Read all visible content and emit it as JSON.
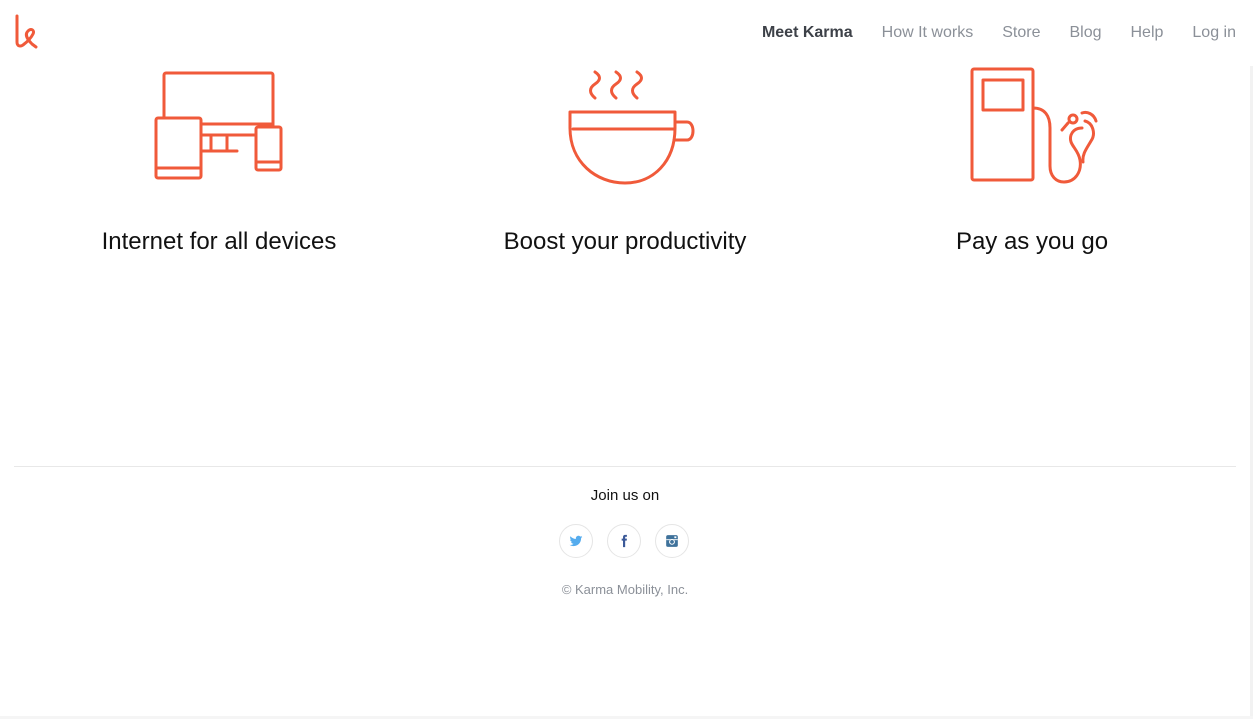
{
  "header": {
    "logo_icon": "karma-logo-icon",
    "nav": [
      {
        "label": "Meet Karma",
        "active": true
      },
      {
        "label": "How It works",
        "active": false
      },
      {
        "label": "Store",
        "active": false
      },
      {
        "label": "Blog",
        "active": false
      },
      {
        "label": "Help",
        "active": false
      },
      {
        "label": "Log in",
        "active": false
      }
    ]
  },
  "features": [
    {
      "icon": "devices-icon",
      "title": "Internet for all devices"
    },
    {
      "icon": "coffee-cup-icon",
      "title": "Boost your productivity"
    },
    {
      "icon": "fuel-pump-icon",
      "title": "Pay as you go"
    }
  ],
  "footer": {
    "join_label": "Join us on",
    "socials": [
      {
        "icon": "twitter-icon",
        "color": "#55acee"
      },
      {
        "icon": "facebook-icon",
        "color": "#3b5998"
      },
      {
        "icon": "instagram-icon",
        "color": "#3f729b"
      }
    ],
    "copyright": "© Karma Mobility, Inc."
  },
  "colors": {
    "accent": "#f05a3a",
    "nav_active": "#3d4148",
    "nav_inactive": "#8b9098"
  }
}
